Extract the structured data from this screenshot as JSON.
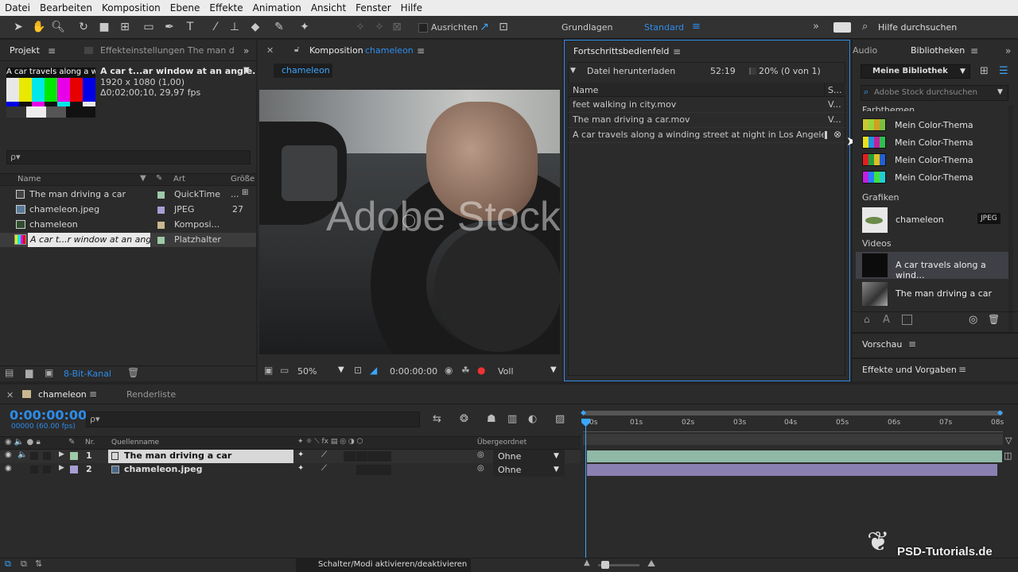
{
  "menu": [
    "Datei",
    "Bearbeiten",
    "Komposition",
    "Ebene",
    "Effekte",
    "Animation",
    "Ansicht",
    "Fenster",
    "Hilfe"
  ],
  "toolbar": {
    "align_label": "Ausrichten",
    "workspace_1": "Grundlagen",
    "workspace_2": "Standard",
    "help_placeholder": "Hilfe durchsuchen"
  },
  "project": {
    "tab_project": "Projekt",
    "tab_effects": "Effekteinstellungen The man d",
    "thumb_caption": "A car travels along a windi",
    "selected_name": "A car t...ar window at an angle.",
    "selected_res": "1920 x 1080 (1,00)",
    "selected_dur": "Δ0;02;00;10, 29,97 fps",
    "search_placeholder": "ρ▾",
    "columns": {
      "name": "Name",
      "type": "Art",
      "size": "Größe"
    },
    "items": [
      {
        "name": "The man driving a car",
        "type": "QuickTime",
        "size": "...",
        "color": "#9ecaa8"
      },
      {
        "name": "chameleon.jpeg",
        "type": "JPEG",
        "size": "27",
        "color": "#a79fd4"
      },
      {
        "name": "chameleon",
        "type": "Komposi...",
        "size": "",
        "color": "#c9b88f"
      },
      {
        "name": "A car t...r window at an angle.",
        "type": "Platzhalter",
        "size": "",
        "color": "#9ecaa8"
      }
    ],
    "bit_depth": "8-Bit-Kanal"
  },
  "composition": {
    "tab_prefix": "Komposition",
    "tab_name": "chameleon",
    "sub_tab": "chameleon",
    "watermark": "Adobe Stock",
    "zoom": "50%",
    "timecode": "0:00:00:00",
    "resolution": "Voll"
  },
  "progress": {
    "tab": "Fortschrittsbedienfeld",
    "task": "Datei herunterladen",
    "time": "52:19",
    "percent": "20% (0 von 1)",
    "col_name": "Name",
    "col_s": "S...",
    "files": [
      {
        "name": "feet walking in city.mov",
        "status": "V..."
      },
      {
        "name": "The man driving a car.mov",
        "status": "V..."
      },
      {
        "name": "A car travels along a winding street at night in Los Angeles...",
        "status": ""
      }
    ]
  },
  "libraries": {
    "tab_audio": "Audio",
    "tab_libraries": "Bibliotheken",
    "library_name": "Meine Bibliothek",
    "search_placeholder": "Adobe Stock durchsuchen",
    "section_colors": "Farbthemen",
    "color_themes": [
      {
        "name": "Mein Color-Thema",
        "colors": [
          "#c8c832",
          "#9ad43c",
          "#d0a020",
          "#7ac040"
        ]
      },
      {
        "name": "Mein Color-Thema",
        "colors": [
          "#e8e020",
          "#2090e0",
          "#c020a0",
          "#30c050"
        ]
      },
      {
        "name": "Mein Color-Thema",
        "colors": [
          "#e02020",
          "#20a040",
          "#e0c020",
          "#2060d0"
        ]
      },
      {
        "name": "Mein Color-Thema",
        "colors": [
          "#c020e0",
          "#2080ff",
          "#40e040",
          "#20d0d0"
        ]
      }
    ],
    "section_graphics": "Grafiken",
    "graphic_name": "chameleon",
    "graphic_badge": "JPEG",
    "section_videos": "Videos",
    "videos": [
      "A car travels along a wind...",
      "The man driving a car"
    ],
    "preview": "Vorschau",
    "effects_presets": "Effekte und Vorgaben"
  },
  "timeline": {
    "tab_comp": "chameleon",
    "tab_render": "Renderliste",
    "timecode": "0:00:00:00",
    "frames": "00000 (60.00 fps)",
    "col_nr": "Nr.",
    "col_source": "Quellenname",
    "col_parent": "Übergeordnet",
    "layers": [
      {
        "nr": "1",
        "name": "The man driving a car",
        "parent": "Ohne",
        "color": "#9ecaa8"
      },
      {
        "nr": "2",
        "name": "chameleon.jpeg",
        "parent": "Ohne",
        "color": "#a79fd4"
      }
    ],
    "ruler": [
      "0s",
      "01s",
      "02s",
      "03s",
      "04s",
      "05s",
      "06s",
      "07s",
      "08s"
    ],
    "toggle_modes": "Schalter/Modi aktivieren/deaktivieren"
  },
  "watermark_logo": "PSD-Tutorials.de"
}
